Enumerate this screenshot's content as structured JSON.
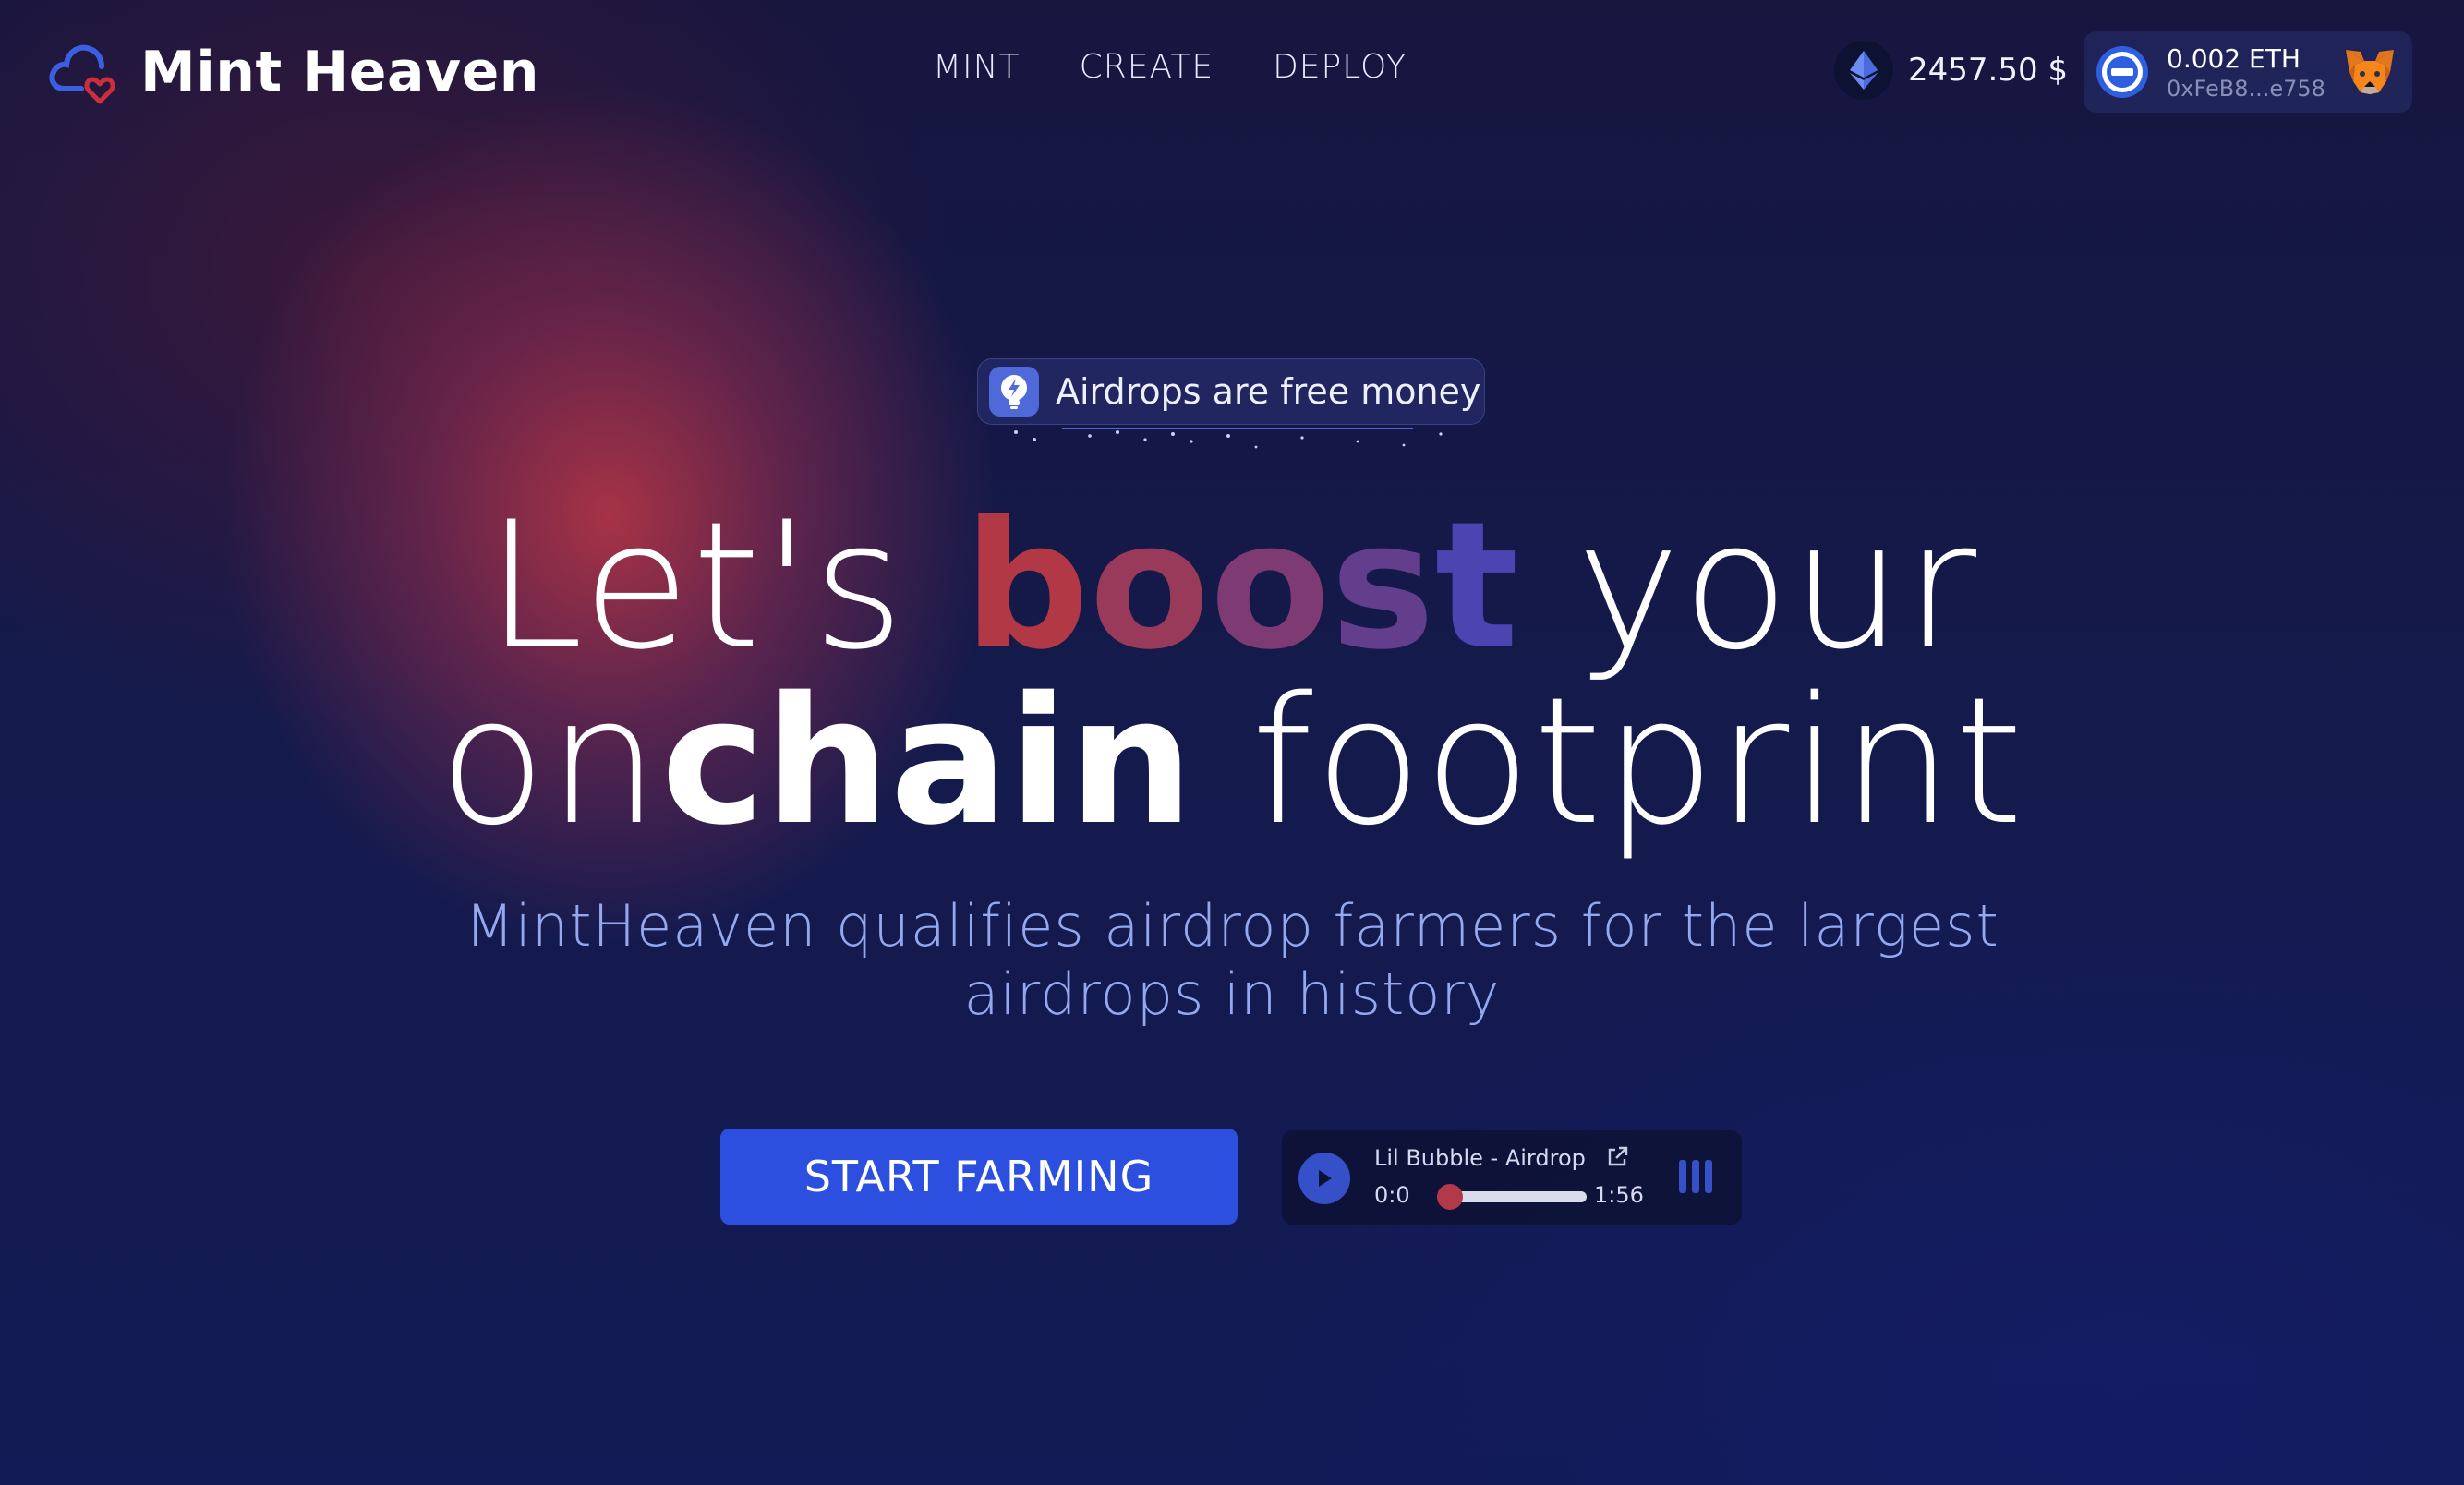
{
  "header": {
    "brand": "Mint Heaven",
    "nav": [
      {
        "label": "MINT"
      },
      {
        "label": "CREATE"
      },
      {
        "label": "DEPLOY"
      }
    ],
    "eth_price": "2457.50 $",
    "wallet": {
      "balance": "0.002 ETH",
      "address": "0xFeB8...e758"
    }
  },
  "hero": {
    "badge": "Airdrops are free money",
    "line1_a": "Let's ",
    "line1_boost": [
      "b",
      "o",
      "o",
      "s",
      "t"
    ],
    "line1_c": " your",
    "line2_a": "on",
    "line2_b": "chain",
    "line2_c": " footprint",
    "subtitle_1": "MintHeaven qualifies airdrop farmers for the largest",
    "subtitle_2": "airdrops in history",
    "cta": "START FARMING"
  },
  "player": {
    "track": "Lil Bubble - Airdrop",
    "current": "0:0",
    "total": "1:56",
    "progress": 0
  },
  "colors": {
    "accent": "#2d4fe0",
    "boost_start": "#b23845",
    "boost_end": "#4c44b0",
    "subtitle": "#93a8ef"
  },
  "icons": {
    "logo": "cloud-heart-icon",
    "eth": "ethereum-icon",
    "wallet": "wallet-connect-icon",
    "metamask": "metamask-fox-icon",
    "badge": "lightbulb-bolt-icon",
    "play": "play-icon",
    "external": "external-link-icon",
    "equalizer": "equalizer-icon"
  }
}
